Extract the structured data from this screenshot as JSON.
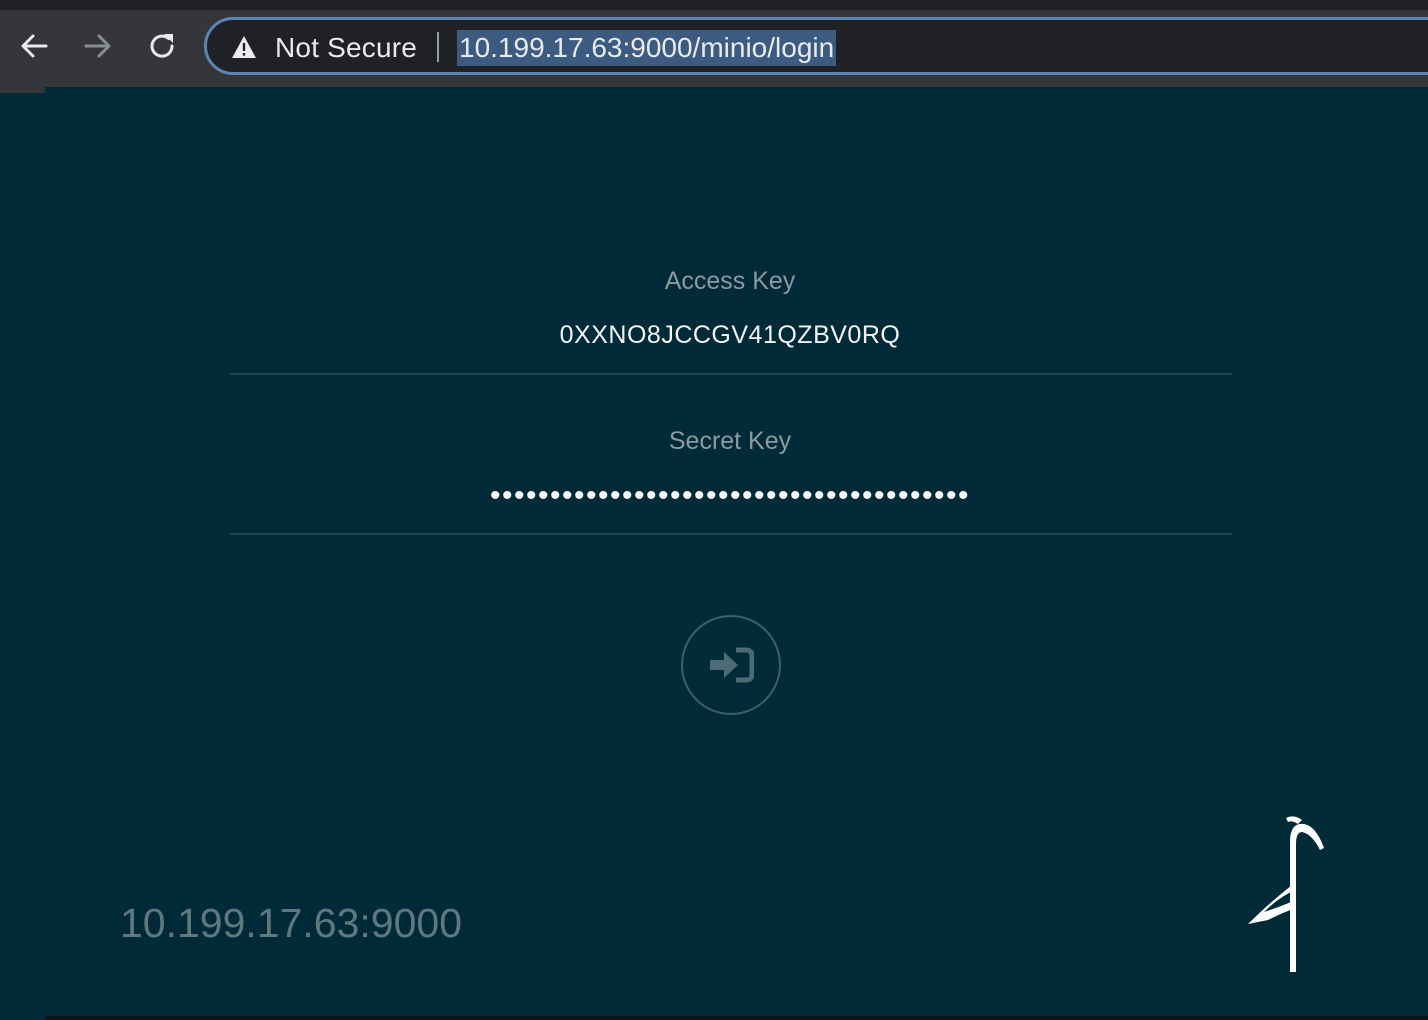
{
  "browser": {
    "back_icon": "arrow-left-icon",
    "forward_icon": "arrow-right-icon",
    "reload_icon": "reload-icon",
    "security_icon": "warning-triangle-icon",
    "security_text": "Not Secure",
    "url": "10.199.17.63:9000/minio/login"
  },
  "login": {
    "access_key_label": "Access Key",
    "access_key_value": "0XXNO8JCCGV41QZBV0RQ",
    "secret_key_label": "Secret Key",
    "secret_key_value": "••••••••••••••••••••••••••••••••••••••••",
    "submit_icon": "sign-in-icon"
  },
  "footer": {
    "host": "10.199.17.63:9000",
    "logo_icon": "minio-bird-logo"
  },
  "colors": {
    "background": "#002a37",
    "toolbar": "#35363a",
    "omnibox": "#202124",
    "url_highlight": "#3d5a80",
    "label_text": "#8a9aa0",
    "host_text": "#5f7880"
  }
}
